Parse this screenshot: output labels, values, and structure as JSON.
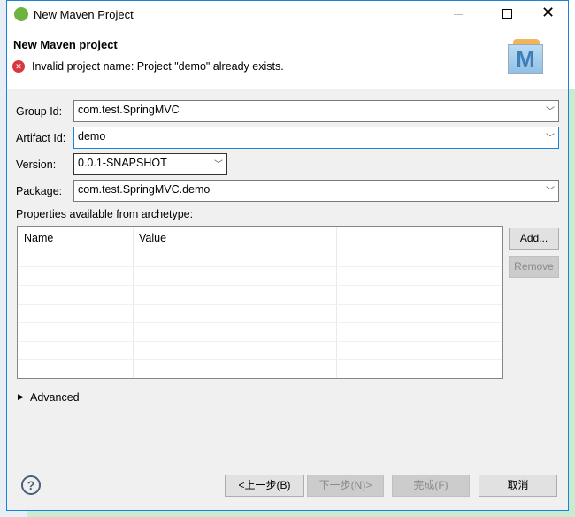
{
  "window": {
    "title": "New Maven Project"
  },
  "header": {
    "title": "New Maven project",
    "error": "Invalid project name: Project \"demo\" already exists."
  },
  "form": {
    "group_id": {
      "label": "Group Id:",
      "value": "com.test.SpringMVC"
    },
    "artifact_id": {
      "label": "Artifact Id:",
      "value": "demo"
    },
    "version": {
      "label": "Version:",
      "value": "0.0.1-SNAPSHOT"
    },
    "package": {
      "label": "Package:",
      "value": "com.test.SpringMVC.demo"
    }
  },
  "properties": {
    "label": "Properties available from archetype:",
    "columns": [
      "Name",
      "Value"
    ],
    "add": "Add...",
    "remove": "Remove"
  },
  "advanced": "Advanced",
  "buttons": {
    "back": "<上一步(B)",
    "next": "下一步(N)>",
    "finish": "完成(F)",
    "cancel": "取消"
  },
  "colors": {
    "accent": "#1883d7",
    "error": "#d9363e"
  }
}
